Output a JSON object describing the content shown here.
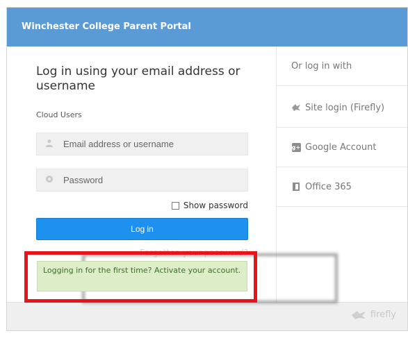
{
  "header": {
    "title": "Winchester College Parent Portal"
  },
  "login": {
    "title": "Log in using your email address or username",
    "section_label": "Cloud Users",
    "email_placeholder": "Email address or username",
    "password_placeholder": "Password",
    "show_password_label": "Show password",
    "login_button": "Log in",
    "forgot_link": "Forgotten your password?",
    "first_time_notice": "Logging in for the first time? Activate your account."
  },
  "alt_login": {
    "header": "Or log in with",
    "options": [
      {
        "label": "Site login (Firefly)",
        "icon": "firefly-icon"
      },
      {
        "label": "Google Account",
        "icon": "google-plus-icon"
      },
      {
        "label": "Office 365",
        "icon": "office-365-icon"
      }
    ]
  },
  "footer": {
    "brand": "firefly"
  },
  "colors": {
    "header_bg": "#5b9bd5",
    "login_button_bg": "#1e90ef",
    "notice_bg": "#dcedc8",
    "highlight_border": "#e8141b"
  }
}
